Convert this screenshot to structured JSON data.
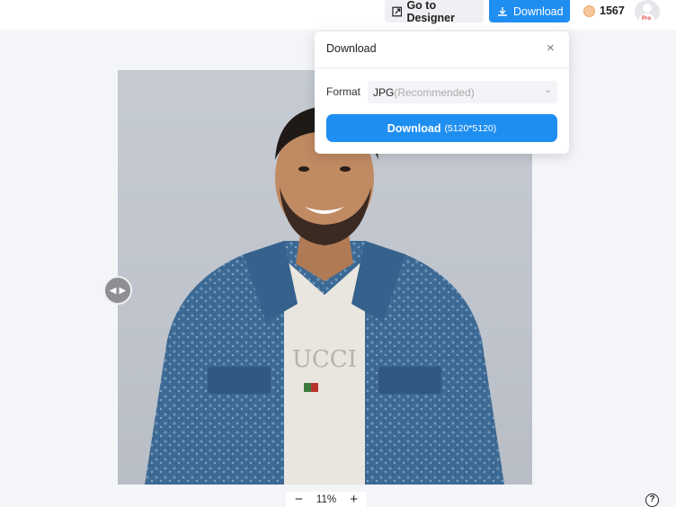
{
  "header": {
    "designer_button": "Go to Designer",
    "download_button": "Download",
    "coin_count": "1567",
    "pro_badge": "Pro"
  },
  "download_panel": {
    "title": "Download",
    "close_icon": "×",
    "format_label": "Format",
    "format_value": "JPG",
    "format_note": "(Recommended)",
    "download_label": "Download",
    "resolution": "(5120*5120)"
  },
  "zoom": {
    "minus": "−",
    "level": "11%",
    "plus": "+"
  },
  "help_icon": "?",
  "icons": {
    "designer": "external-edit-icon",
    "download": "download-icon",
    "coin": "coin-icon",
    "avatar": "user-avatar-icon",
    "close": "close-icon",
    "chevron": "chevron-down-icon",
    "compare": "compare-slider-icon",
    "help": "help-icon"
  },
  "colors": {
    "accent": "#1f8ef1",
    "background": "#f3f5f9"
  }
}
